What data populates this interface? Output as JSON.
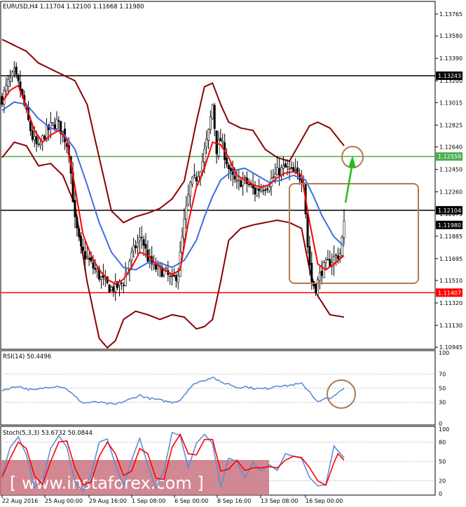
{
  "colors": {
    "bollinger": "#8b0000",
    "ma_fast": "#ff0000",
    "ma_slow": "#3b6fe0",
    "rsi": "#5b8fd8",
    "stoch_main": "#5b8fd8",
    "stoch_signal": "#ff0000",
    "green_line": "#4caf50",
    "arrow": "#22bb22",
    "annotation": "#b07a4f",
    "watermark_band": "#c9737f"
  },
  "chart_data": [
    {
      "type": "candlestick",
      "title": "EURUSD,H4  1.11704 1.12100 1.11668 1.11980",
      "ylim": [
        1.1094,
        1.1386
      ],
      "y_ticks": [
        "1.13765",
        "1.13580",
        "1.13390",
        "1.13200",
        "1.13015",
        "1.12825",
        "1.12640",
        "1.12450",
        "1.12260",
        "1.12075",
        "1.11885",
        "1.11695",
        "1.11510",
        "1.11320",
        "1.11130",
        "1.10945"
      ],
      "x_tick_labels": [
        "22 Aug 2016",
        "25 Aug 00:00",
        "29 Aug 16:00",
        "1 Sep 08:00",
        "6 Sep 00:00",
        "8 Sep 16:00",
        "13 Sep 08:00",
        "16 Sep 00:00"
      ],
      "levels": [
        {
          "label": "1.13243",
          "value": 1.13243,
          "color": "#000000",
          "tag": "#000000"
        },
        {
          "label": "1.12559",
          "value": 1.12559,
          "color": "#4caf50",
          "tag": "#4caf50"
        },
        {
          "label": "1.12104",
          "value": 1.12104,
          "color": "#000000",
          "tag": "#000000"
        },
        {
          "label": "1.11980",
          "value": 1.1198,
          "color": "none",
          "tag": "#000000"
        },
        {
          "label": "1.11407",
          "value": 1.11407,
          "color": "#ff0000",
          "tag": "#ff0000"
        }
      ],
      "close_anchors": [
        [
          0,
          1.1305
        ],
        [
          3,
          1.1318
        ],
        [
          6,
          1.1326
        ],
        [
          9,
          1.1312
        ],
        [
          12,
          1.1292
        ],
        [
          15,
          1.1272
        ],
        [
          18,
          1.1262
        ],
        [
          21,
          1.1275
        ],
        [
          24,
          1.1281
        ],
        [
          27,
          1.1285
        ],
        [
          30,
          1.1276
        ],
        [
          33,
          1.1262
        ],
        [
          36,
          1.1201
        ],
        [
          39,
          1.1176
        ],
        [
          42,
          1.117
        ],
        [
          45,
          1.1162
        ],
        [
          48,
          1.1155
        ],
        [
          51,
          1.1148
        ],
        [
          54,
          1.1144
        ],
        [
          57,
          1.1146
        ],
        [
          60,
          1.115
        ],
        [
          63,
          1.1168
        ],
        [
          66,
          1.118
        ],
        [
          69,
          1.1188
        ],
        [
          72,
          1.117
        ],
        [
          75,
          1.1162
        ],
        [
          78,
          1.116
        ],
        [
          81,
          1.1157
        ],
        [
          84,
          1.115
        ],
        [
          87,
          1.1158
        ],
        [
          90,
          1.12
        ],
        [
          93,
          1.1232
        ],
        [
          96,
          1.1238
        ],
        [
          99,
          1.1252
        ],
        [
          102,
          1.1276
        ],
        [
          104,
          1.13
        ],
        [
          106,
          1.1262
        ],
        [
          108,
          1.127
        ],
        [
          110,
          1.1258
        ],
        [
          113,
          1.124
        ],
        [
          116,
          1.1232
        ],
        [
          119,
          1.1236
        ],
        [
          122,
          1.1232
        ],
        [
          125,
          1.1226
        ],
        [
          128,
          1.123
        ],
        [
          131,
          1.1232
        ],
        [
          134,
          1.1238
        ],
        [
          137,
          1.1244
        ],
        [
          140,
          1.1246
        ],
        [
          143,
          1.1243
        ],
        [
          146,
          1.124
        ],
        [
          149,
          1.1238
        ],
        [
          151,
          1.118
        ],
        [
          153,
          1.115
        ],
        [
          155,
          1.1145
        ],
        [
          158,
          1.116
        ],
        [
          161,
          1.1165
        ],
        [
          164,
          1.117
        ],
        [
          167,
          1.1174
        ],
        [
          169,
          1.1198
        ]
      ],
      "bollinger_upper": [
        [
          0,
          1.1355
        ],
        [
          6,
          1.135
        ],
        [
          12,
          1.1345
        ],
        [
          18,
          1.1335
        ],
        [
          24,
          1.133
        ],
        [
          30,
          1.1325
        ],
        [
          36,
          1.132
        ],
        [
          42,
          1.13
        ],
        [
          48,
          1.1255
        ],
        [
          54,
          1.121
        ],
        [
          60,
          1.12
        ],
        [
          66,
          1.1205
        ],
        [
          72,
          1.1208
        ],
        [
          78,
          1.1212
        ],
        [
          84,
          1.122
        ],
        [
          90,
          1.1235
        ],
        [
          96,
          1.1285
        ],
        [
          100,
          1.1315
        ],
        [
          104,
          1.1318
        ],
        [
          108,
          1.13
        ],
        [
          112,
          1.1285
        ],
        [
          118,
          1.128
        ],
        [
          124,
          1.1278
        ],
        [
          130,
          1.1262
        ],
        [
          136,
          1.1255
        ],
        [
          142,
          1.1252
        ],
        [
          148,
          1.127
        ],
        [
          152,
          1.1282
        ],
        [
          156,
          1.1285
        ],
        [
          162,
          1.128
        ],
        [
          169,
          1.1265
        ]
      ],
      "bollinger_lower": [
        [
          0,
          1.1255
        ],
        [
          6,
          1.1268
        ],
        [
          12,
          1.1265
        ],
        [
          18,
          1.1248
        ],
        [
          24,
          1.125
        ],
        [
          30,
          1.124
        ],
        [
          36,
          1.1215
        ],
        [
          42,
          1.115
        ],
        [
          48,
          1.1102
        ],
        [
          52,
          1.1094
        ],
        [
          56,
          1.11
        ],
        [
          60,
          1.1118
        ],
        [
          66,
          1.1125
        ],
        [
          72,
          1.1122
        ],
        [
          78,
          1.1118
        ],
        [
          84,
          1.1122
        ],
        [
          90,
          1.112
        ],
        [
          96,
          1.111
        ],
        [
          100,
          1.1112
        ],
        [
          104,
          1.1118
        ],
        [
          108,
          1.115
        ],
        [
          112,
          1.1185
        ],
        [
          118,
          1.1195
        ],
        [
          124,
          1.1198
        ],
        [
          130,
          1.12
        ],
        [
          136,
          1.1202
        ],
        [
          142,
          1.12
        ],
        [
          148,
          1.1195
        ],
        [
          152,
          1.116
        ],
        [
          156,
          1.1138
        ],
        [
          162,
          1.1122
        ],
        [
          169,
          1.112
        ]
      ],
      "ma_fast": [
        [
          0,
          1.1302
        ],
        [
          4,
          1.1312
        ],
        [
          8,
          1.1316
        ],
        [
          12,
          1.1298
        ],
        [
          16,
          1.1278
        ],
        [
          20,
          1.1268
        ],
        [
          24,
          1.1274
        ],
        [
          28,
          1.1278
        ],
        [
          32,
          1.127
        ],
        [
          36,
          1.123
        ],
        [
          40,
          1.119
        ],
        [
          44,
          1.1172
        ],
        [
          48,
          1.116
        ],
        [
          52,
          1.1152
        ],
        [
          56,
          1.1148
        ],
        [
          60,
          1.1152
        ],
        [
          64,
          1.1162
        ],
        [
          68,
          1.1175
        ],
        [
          72,
          1.1172
        ],
        [
          76,
          1.1165
        ],
        [
          80,
          1.116
        ],
        [
          84,
          1.1156
        ],
        [
          88,
          1.116
        ],
        [
          92,
          1.12
        ],
        [
          96,
          1.123
        ],
        [
          100,
          1.1246
        ],
        [
          104,
          1.1268
        ],
        [
          108,
          1.1266
        ],
        [
          112,
          1.1255
        ],
        [
          116,
          1.124
        ],
        [
          120,
          1.1236
        ],
        [
          124,
          1.1232
        ],
        [
          128,
          1.123
        ],
        [
          132,
          1.1232
        ],
        [
          136,
          1.1238
        ],
        [
          140,
          1.1242
        ],
        [
          144,
          1.1243
        ],
        [
          148,
          1.124
        ],
        [
          152,
          1.12
        ],
        [
          156,
          1.1165
        ],
        [
          160,
          1.116
        ],
        [
          164,
          1.1165
        ],
        [
          169,
          1.1172
        ]
      ],
      "ma_slow": [
        [
          0,
          1.1295
        ],
        [
          6,
          1.1302
        ],
        [
          12,
          1.13
        ],
        [
          18,
          1.1288
        ],
        [
          24,
          1.128
        ],
        [
          30,
          1.1276
        ],
        [
          36,
          1.1262
        ],
        [
          42,
          1.1232
        ],
        [
          48,
          1.12
        ],
        [
          54,
          1.1175
        ],
        [
          60,
          1.1162
        ],
        [
          66,
          1.116
        ],
        [
          72,
          1.1166
        ],
        [
          78,
          1.1166
        ],
        [
          84,
          1.1162
        ],
        [
          90,
          1.1168
        ],
        [
          96,
          1.1185
        ],
        [
          100,
          1.1205
        ],
        [
          104,
          1.1222
        ],
        [
          108,
          1.1236
        ],
        [
          114,
          1.1244
        ],
        [
          120,
          1.1246
        ],
        [
          126,
          1.124
        ],
        [
          132,
          1.1234
        ],
        [
          138,
          1.1236
        ],
        [
          144,
          1.124
        ],
        [
          150,
          1.1236
        ],
        [
          154,
          1.1222
        ],
        [
          158,
          1.1206
        ],
        [
          164,
          1.1188
        ],
        [
          169,
          1.118
        ]
      ]
    },
    {
      "type": "line",
      "title": "RSI(14) 50.4496",
      "ylim": [
        0,
        100
      ],
      "y_ticks": [
        "100",
        "70",
        "50",
        "30",
        "0"
      ],
      "values_anchors": [
        [
          0,
          47
        ],
        [
          4,
          50
        ],
        [
          8,
          53
        ],
        [
          12,
          49
        ],
        [
          16,
          47
        ],
        [
          20,
          50
        ],
        [
          24,
          52
        ],
        [
          28,
          53
        ],
        [
          32,
          49
        ],
        [
          36,
          38
        ],
        [
          40,
          29
        ],
        [
          44,
          30
        ],
        [
          48,
          30
        ],
        [
          52,
          28
        ],
        [
          56,
          27
        ],
        [
          60,
          31
        ],
        [
          64,
          35
        ],
        [
          68,
          40
        ],
        [
          72,
          36
        ],
        [
          76,
          34
        ],
        [
          80,
          32
        ],
        [
          84,
          30
        ],
        [
          88,
          33
        ],
        [
          92,
          48
        ],
        [
          96,
          58
        ],
        [
          100,
          61
        ],
        [
          104,
          66
        ],
        [
          108,
          58
        ],
        [
          112,
          56
        ],
        [
          116,
          51
        ],
        [
          120,
          52
        ],
        [
          124,
          50
        ],
        [
          128,
          49
        ],
        [
          132,
          50
        ],
        [
          136,
          54
        ],
        [
          140,
          53
        ],
        [
          144,
          55
        ],
        [
          148,
          56
        ],
        [
          152,
          45
        ],
        [
          156,
          30
        ],
        [
          160,
          35
        ],
        [
          164,
          38
        ],
        [
          169,
          50
        ]
      ]
    },
    {
      "type": "line",
      "title": "Stoch(5,3,3) 53.6732 50.0844",
      "ylim": [
        0,
        100
      ],
      "y_ticks": [
        "100",
        "80",
        "50",
        "20",
        "0"
      ],
      "main_anchors": [
        [
          0,
          30
        ],
        [
          4,
          72
        ],
        [
          8,
          88
        ],
        [
          12,
          60
        ],
        [
          16,
          10
        ],
        [
          20,
          20
        ],
        [
          24,
          70
        ],
        [
          28,
          90
        ],
        [
          32,
          72
        ],
        [
          36,
          18
        ],
        [
          40,
          4
        ],
        [
          44,
          30
        ],
        [
          48,
          80
        ],
        [
          52,
          85
        ],
        [
          56,
          45
        ],
        [
          60,
          12
        ],
        [
          64,
          52
        ],
        [
          68,
          86
        ],
        [
          72,
          45
        ],
        [
          76,
          8
        ],
        [
          80,
          35
        ],
        [
          84,
          95
        ],
        [
          88,
          90
        ],
        [
          92,
          40
        ],
        [
          96,
          78
        ],
        [
          100,
          92
        ],
        [
          104,
          78
        ],
        [
          108,
          10
        ],
        [
          112,
          55
        ],
        [
          116,
          50
        ],
        [
          120,
          24
        ],
        [
          124,
          48
        ],
        [
          128,
          35
        ],
        [
          132,
          45
        ],
        [
          136,
          36
        ],
        [
          140,
          62
        ],
        [
          144,
          58
        ],
        [
          148,
          55
        ],
        [
          152,
          25
        ],
        [
          156,
          12
        ],
        [
          160,
          14
        ],
        [
          164,
          74
        ],
        [
          166,
          66
        ],
        [
          169,
          56
        ]
      ],
      "signal_anchors": [
        [
          0,
          26
        ],
        [
          4,
          55
        ],
        [
          8,
          80
        ],
        [
          12,
          70
        ],
        [
          16,
          28
        ],
        [
          20,
          14
        ],
        [
          24,
          50
        ],
        [
          28,
          80
        ],
        [
          32,
          82
        ],
        [
          36,
          40
        ],
        [
          40,
          14
        ],
        [
          44,
          18
        ],
        [
          48,
          58
        ],
        [
          52,
          80
        ],
        [
          56,
          62
        ],
        [
          60,
          28
        ],
        [
          64,
          35
        ],
        [
          68,
          70
        ],
        [
          72,
          62
        ],
        [
          76,
          24
        ],
        [
          80,
          22
        ],
        [
          84,
          72
        ],
        [
          88,
          92
        ],
        [
          92,
          62
        ],
        [
          96,
          60
        ],
        [
          100,
          84
        ],
        [
          104,
          84
        ],
        [
          108,
          35
        ],
        [
          112,
          38
        ],
        [
          116,
          52
        ],
        [
          120,
          36
        ],
        [
          124,
          40
        ],
        [
          128,
          40
        ],
        [
          132,
          42
        ],
        [
          136,
          40
        ],
        [
          140,
          52
        ],
        [
          144,
          58
        ],
        [
          148,
          56
        ],
        [
          152,
          40
        ],
        [
          156,
          20
        ],
        [
          160,
          13
        ],
        [
          164,
          48
        ],
        [
          166,
          62
        ],
        [
          169,
          52
        ]
      ]
    }
  ],
  "annotations": {
    "rect_label": "",
    "watermark": "[ www.instaforex.com ]"
  }
}
